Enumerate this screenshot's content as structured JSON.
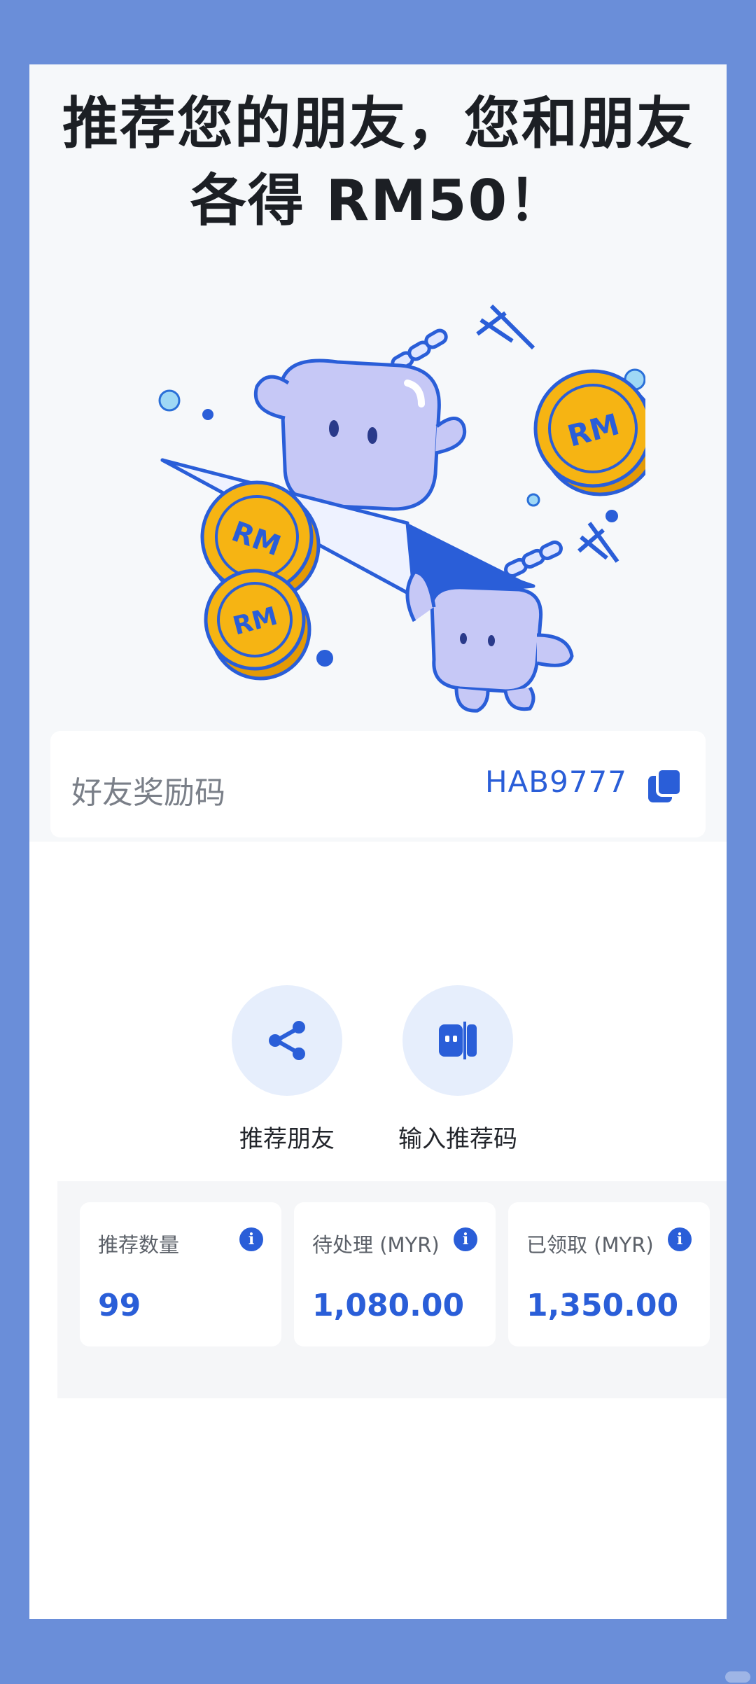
{
  "headline": {
    "line1": "推荐您的朋友，您和朋友",
    "line2": "各得 RM50！"
  },
  "illustration": {
    "coin_text": "RM"
  },
  "referral_code": {
    "label": "好友奖励码",
    "value": "HAB9777",
    "copy_icon": "copy-icon"
  },
  "actions": [
    {
      "label": "推荐朋友",
      "icon": "share-icon"
    },
    {
      "label": "输入推荐码",
      "icon": "code-entry-icon"
    }
  ],
  "stats": [
    {
      "title": "推荐数量",
      "value": "99"
    },
    {
      "title": "待处理 (MYR)",
      "value": "1,080.00"
    },
    {
      "title": "已领取 (MYR)",
      "value": "1,350.00"
    }
  ],
  "colors": {
    "accent": "#2a5ed8",
    "background": "#6a8ed9",
    "coin": "#f6b413"
  }
}
